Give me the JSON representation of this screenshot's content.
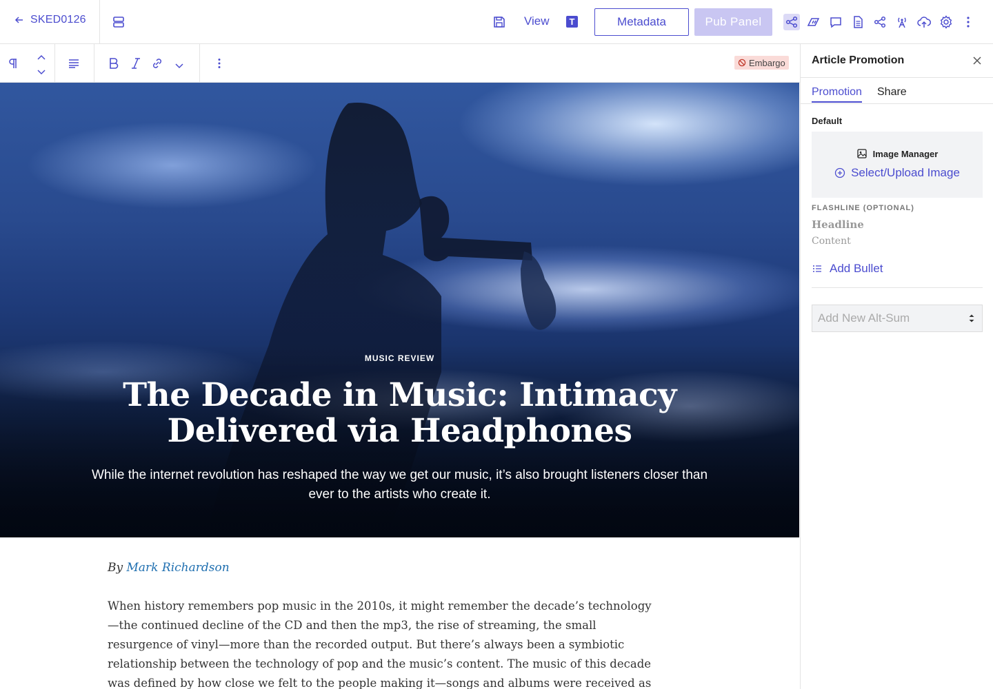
{
  "topbar": {
    "back_label": "SKED0126",
    "view_label": "View",
    "t_label": "T",
    "metadata_label": "Metadata",
    "pub_panel_label": "Pub  Panel",
    "icons": [
      "layout-icon",
      "save-icon",
      "share-network-icon",
      "analytics-icon",
      "comment-icon",
      "document-icon",
      "share-icon",
      "broadcast-icon",
      "cloud-upload-icon",
      "settings-icon",
      "more-vertical-icon"
    ]
  },
  "editor_toolbar": {
    "icons": [
      "paragraph-icon",
      "chevron-up-icon",
      "chevron-down-icon",
      "align-icon",
      "bold-icon",
      "italic-icon",
      "link-icon",
      "chevron-down-icon",
      "more-vertical-icon"
    ],
    "embargo_label": "Embargo"
  },
  "hero": {
    "kicker": "MUSIC REVIEW",
    "title": "The Decade in Music: Intimacy Delivered via Headphones",
    "dek": "While the internet revolution has reshaped the way we get our music, it’s also brought listeners closer than ever to the artists who create it."
  },
  "article": {
    "byline_prefix": "By",
    "author": "Mark Richardson",
    "body": "When history remembers pop music in the 2010s, it might remember the decade’s technology—the continued decline of the CD and then the mp3, the rise of streaming, the small resurgence of vinyl—more than the recorded output. But there’s always been a symbiotic relationship between the technology of pop and the music’s content. The music of this decade was defined by how close we felt to the people making it—songs and albums were received as direct transmissions from artists to fans, and"
  },
  "panel": {
    "title": "Article Promotion",
    "tabs": [
      {
        "label": "Promotion",
        "active": true
      },
      {
        "label": "Share",
        "active": false
      }
    ],
    "default_label": "Default",
    "image_manager_label": "Image Manager",
    "select_upload_label": "Select/Upload Image",
    "flashline_label": "FLASHLINE (OPTIONAL)",
    "headline_placeholder": "Headline",
    "content_placeholder": "Content",
    "add_bullet_label": "Add Bullet",
    "alt_sum_placeholder": "Add New Alt-Sum"
  },
  "colors": {
    "accent": "#4b4ccf",
    "pub_panel_disabled": "#c9c6f2",
    "embargo_bg": "#fadbd8",
    "author_link": "#1f6fb0"
  }
}
